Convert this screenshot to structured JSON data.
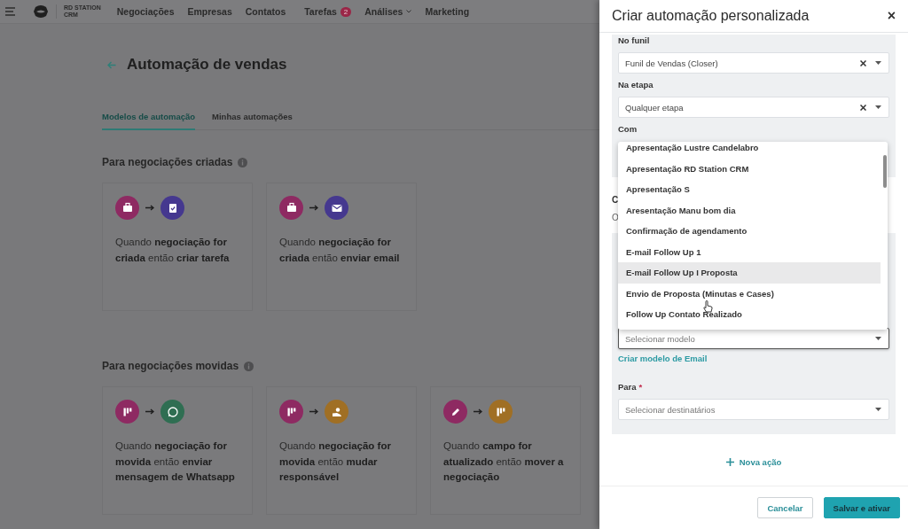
{
  "topbar": {
    "brand": "RD STATION",
    "brand_sub": "CRM",
    "nav": [
      {
        "label": "Negociações"
      },
      {
        "label": "Empresas"
      },
      {
        "label": "Contatos"
      },
      {
        "label": "Tarefas",
        "badge": "2"
      },
      {
        "label": "Análises",
        "dropdown": true
      },
      {
        "label": "Marketing"
      }
    ]
  },
  "page": {
    "title": "Automação de vendas",
    "tabs": [
      {
        "label": "Modelos de automação",
        "selected": true
      },
      {
        "label": "Minhas automações",
        "selected": false
      }
    ],
    "sections": [
      {
        "title": "Para negociações criadas",
        "cards": [
          {
            "icons": [
              {
                "kind": "briefcase",
                "color": "#8e2a62"
              },
              {
                "kind": "clipboard",
                "color": "#45388f"
              }
            ],
            "text": "Quando **negociação for criada** então **criar tarefa**"
          },
          {
            "icons": [
              {
                "kind": "briefcase",
                "color": "#8e2a62"
              },
              {
                "kind": "envelope",
                "color": "#45388f"
              }
            ],
            "text": "Quando **negociação for criada** então **enviar email**"
          }
        ]
      },
      {
        "title": "Para negociações movidas",
        "cards": [
          {
            "icons": [
              {
                "kind": "pipeline",
                "color": "#8e2a62"
              },
              {
                "kind": "whatsapp",
                "color": "#2f6e52"
              }
            ],
            "text": "Quando **negociação for movida** então **enviar mensagem de Whatsapp**"
          },
          {
            "icons": [
              {
                "kind": "pipeline",
                "color": "#8e2a62"
              },
              {
                "kind": "person",
                "color": "#a06f24"
              }
            ],
            "text": "Quando **negociação for movida** então **mudar responsável**"
          },
          {
            "icons": [
              {
                "kind": "pencil",
                "color": "#8e2a62"
              },
              {
                "kind": "pipeline",
                "color": "#a06f24"
              }
            ],
            "text": "Quando **campo for atualizado** então **mover a negociação**"
          }
        ]
      }
    ]
  },
  "drawer": {
    "title": "Criar automação personalizada",
    "close": "×",
    "trigger_fields": [
      {
        "label": "No funil",
        "value": "Funil de Vendas (Closer)",
        "clearable": true
      },
      {
        "label": "Na etapa",
        "value": "Qualquer etapa",
        "clearable": true
      }
    ],
    "com_label": "Com",
    "partial_label": "C",
    "partial_hint": "O",
    "dropdown": {
      "options": [
        {
          "label": "Apresentação Lustre Candelabro",
          "highlighted": false
        },
        {
          "label": "Apresentação RD Station CRM",
          "highlighted": false
        },
        {
          "label": "Apresentação S",
          "highlighted": false
        },
        {
          "label": "Aresentação Manu bom dia",
          "highlighted": false
        },
        {
          "label": "Confirmação de agendamento",
          "highlighted": false
        },
        {
          "label": "E-mail Follow Up 1",
          "highlighted": false
        },
        {
          "label": "E-mail Follow Up I Proposta",
          "highlighted": true
        },
        {
          "label": "Envio de Proposta (Minutas e Cases)",
          "highlighted": false
        },
        {
          "label": "Follow Up Contato Realizado",
          "highlighted": false
        }
      ]
    },
    "model_field": {
      "placeholder": "Selecionar modelo",
      "focused": true
    },
    "create_link": "Criar modelo de Email",
    "recipient_field": {
      "label": "Para",
      "required_mark": "*",
      "placeholder": "Selecionar destinatários"
    },
    "add_action": "Nova ação",
    "buttons": [
      {
        "label": "Cancelar",
        "kind": "secondary"
      },
      {
        "label": "Salvar e ativar",
        "kind": "primary"
      }
    ]
  }
}
